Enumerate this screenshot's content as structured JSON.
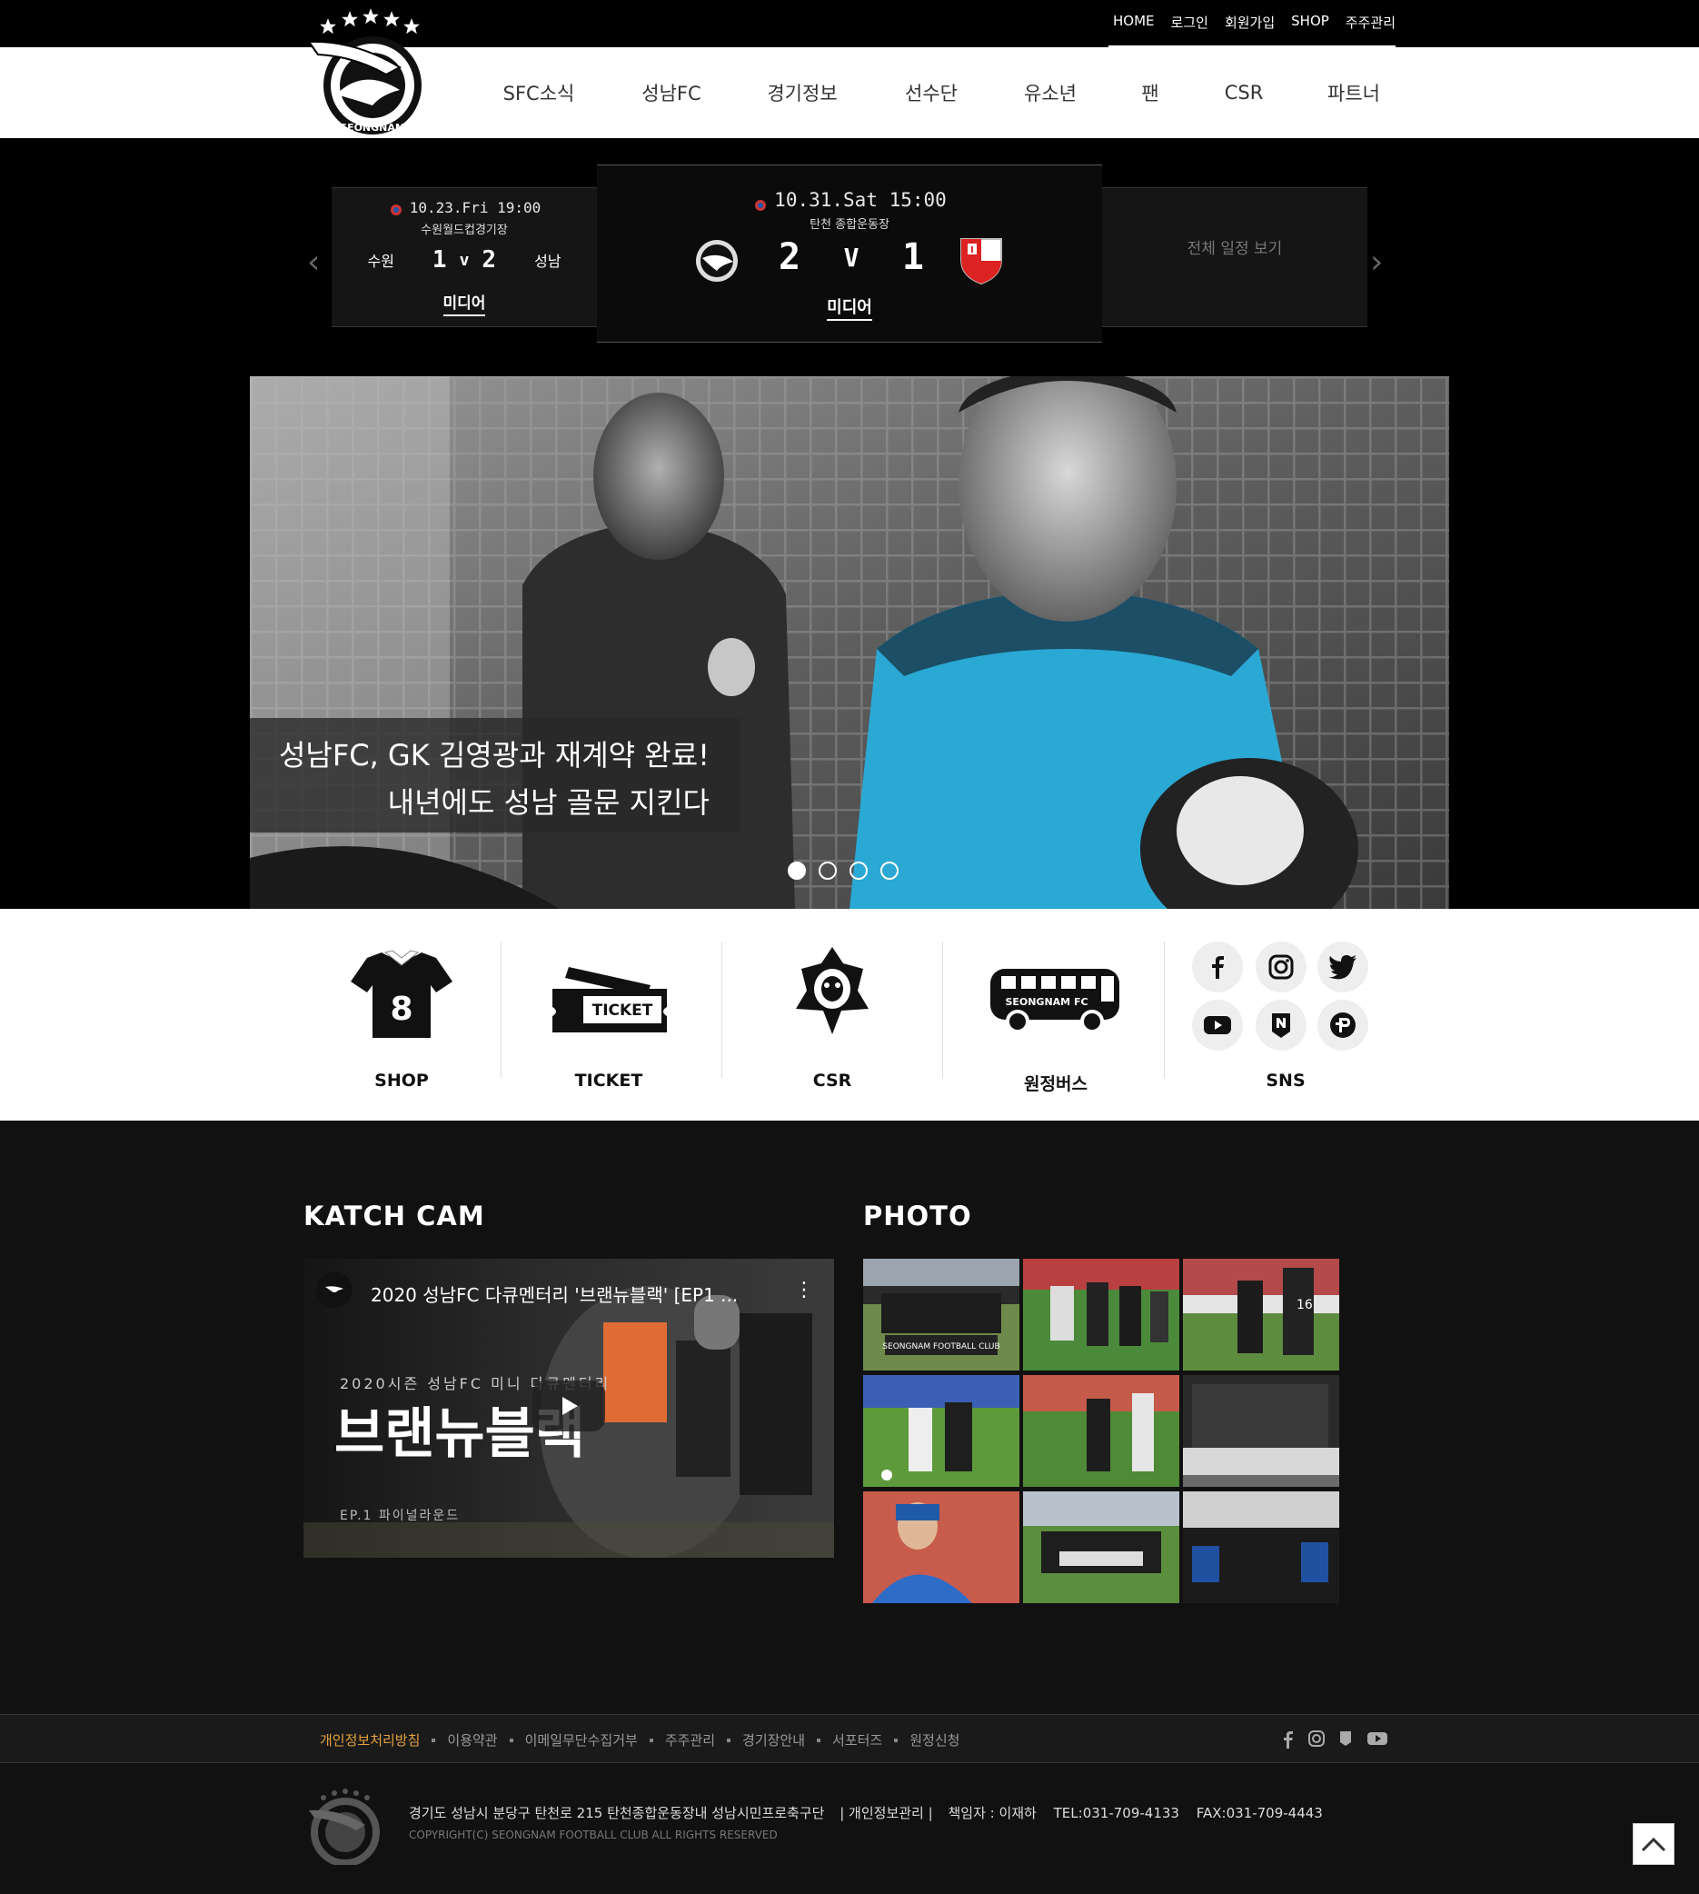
{
  "utility_nav": [
    "HOME",
    "로그인",
    "회원가입",
    "SHOP",
    "주주관리"
  ],
  "main_nav": [
    "SFC소식",
    "성남FC",
    "경기정보",
    "선수단",
    "유소년",
    "팬",
    "CSR",
    "파트너"
  ],
  "matches": {
    "prev": {
      "datetime": "10.23.Fri 19:00",
      "venue": "수원월드컵경기장",
      "home": "수원",
      "home_score": "1",
      "vs": "v",
      "away_score": "2",
      "away": "성남",
      "media": "미디어"
    },
    "current": {
      "datetime": "10.31.Sat 15:00",
      "venue": "탄천 종합운동장",
      "home_score": "2",
      "vs": "V",
      "away_score": "1",
      "media": "미디어"
    },
    "schedule_link": "전체 일정 보기"
  },
  "hero": {
    "line1": "성남FC, GK 김영광과 재계약 완료!",
    "line2": "내년에도 성남 골문 지킨다",
    "active_slide": 1,
    "slide_count": 4
  },
  "quick_menu": {
    "shop": "SHOP",
    "ticket": "TICKET",
    "ticket_art": "TICKET",
    "csr": "CSR",
    "bus": "원정버스",
    "bus_art": "SEONGNAM FC",
    "sns": "SNS",
    "jersey_number": "8",
    "sns_icons": [
      "facebook-icon",
      "instagram-icon",
      "twitter-icon",
      "youtube-icon",
      "naver-post-icon",
      "kakao-icon"
    ]
  },
  "katch_cam": {
    "title": "KATCH CAM",
    "video_title": "2020 성남FC 다큐멘터리 '브랜뉴블랙' [EP1 ...",
    "video_subtitle": "2020시즌 성남FC 미니 다큐멘터리",
    "video_big": "브랜뉴블랙",
    "video_ep": "EP.1 파이널라운드"
  },
  "photo": {
    "title": "PHOTO",
    "count": 9
  },
  "footer_links": [
    "개인정보처리방침",
    "이용약관",
    "이메일무단수집거부",
    "주주관리",
    "경기장안내",
    "서포터즈",
    "원정신청"
  ],
  "footer": {
    "address": "경기도 성남시 분당구 탄천로 215 탄천종합운동장내 성남시민프로축구단",
    "privacy": "| 개인정보관리 |",
    "manager": "책임자 : 이재하",
    "tel": "TEL:031-709-4133",
    "fax": "FAX:031-709-4443",
    "copyright": "COPYRIGHT(C) SEONGNAM FOOTBALL CLUB ALL RIGHTS RESERVED"
  },
  "colors": {
    "accent_footer_link": "#e6a23c",
    "jersey_blue": "#1e9cc4"
  }
}
